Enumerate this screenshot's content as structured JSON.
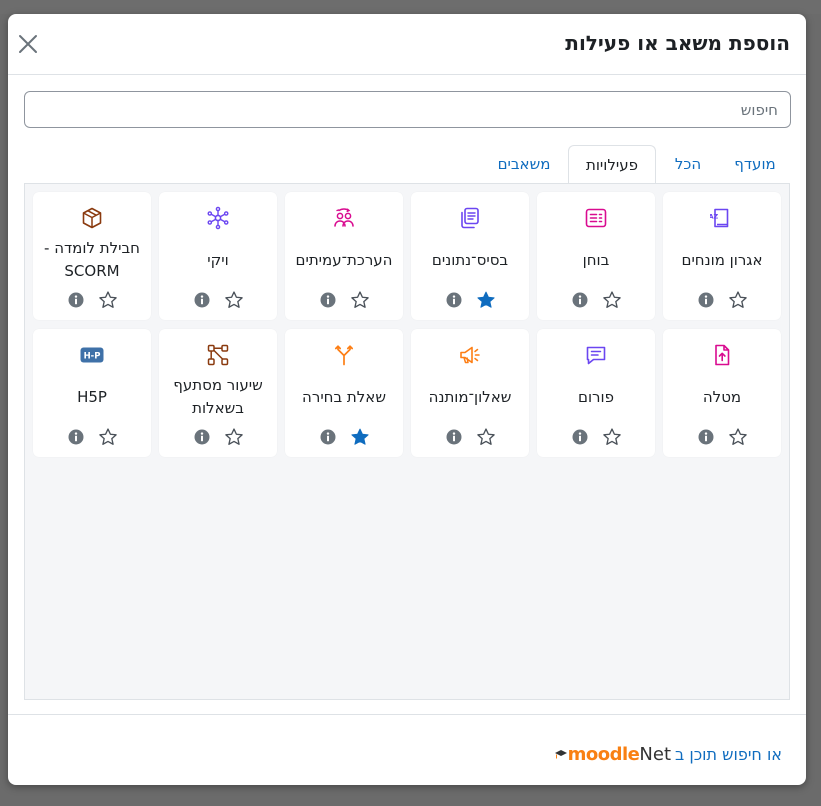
{
  "modal": {
    "title": "הוספת משאב או פעילות",
    "close_label": "×"
  },
  "search": {
    "placeholder": "חיפוש"
  },
  "tabs": [
    {
      "label": "מועדף"
    },
    {
      "label": "הכל"
    },
    {
      "label": "פעילויות",
      "active": true
    },
    {
      "label": "משאבים"
    }
  ],
  "colors": {
    "accent": "#0f6cbf",
    "assessment": "#d90b90",
    "collaboration": "#6b46f1",
    "content": "#8a3a0f",
    "communication": "#fd7e14",
    "h5p": "#3f71a8",
    "star_filled": "#0f6cbf"
  },
  "activities": [
    {
      "label": "אגרון מונחים",
      "icon": "glossary-icon",
      "favourite": false
    },
    {
      "label": "בוחן",
      "icon": "quiz-icon",
      "favourite": false
    },
    {
      "label": "בסיס־נתונים",
      "icon": "database-icon",
      "favourite": true
    },
    {
      "label": "הערכת־עמיתים",
      "icon": "workshop-icon",
      "favourite": false
    },
    {
      "label": "ויקי",
      "icon": "wiki-icon",
      "favourite": false
    },
    {
      "label": "חבילת לומדה - SCORM",
      "icon": "scorm-package-icon",
      "favourite": false
    },
    {
      "label": "מטלה",
      "icon": "assignment-icon",
      "favourite": false
    },
    {
      "label": "פורום",
      "icon": "forum-icon",
      "favourite": false
    },
    {
      "label": "שאלון־מותנה",
      "icon": "feedback-icon",
      "favourite": false
    },
    {
      "label": "שאלת בחירה",
      "icon": "choice-icon",
      "favourite": true
    },
    {
      "label": "שיעור מסתעף בשאלות",
      "icon": "lesson-icon",
      "favourite": false
    },
    {
      "label": "H5P",
      "icon": "h5p-icon",
      "favourite": false
    }
  ],
  "footer": {
    "prefix": "או חיפוש תוכן ב",
    "logo_moodle": "moodle",
    "logo_net": "Net"
  }
}
